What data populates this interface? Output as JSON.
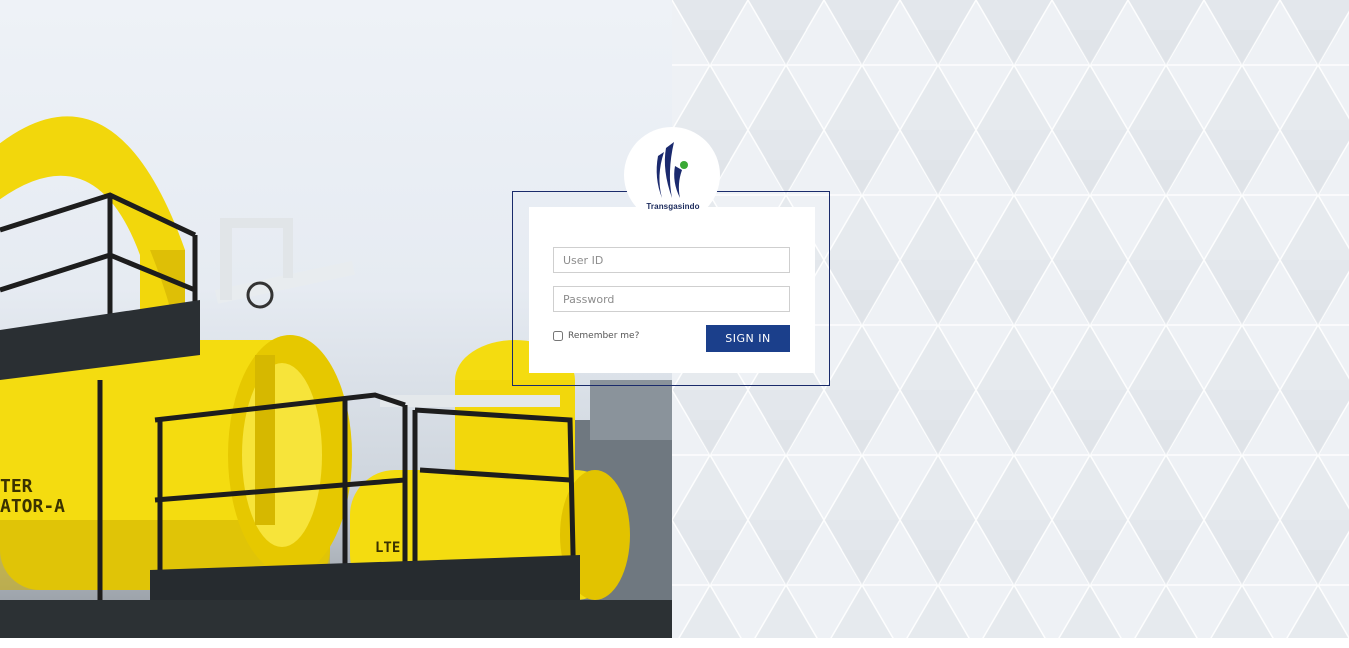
{
  "brand": {
    "name": "Transgasindo",
    "logo_icon": "tgi-logo-icon",
    "primary_color": "#1b3f8b",
    "accent_color": "#3aa935"
  },
  "login": {
    "user_placeholder": "User ID",
    "password_placeholder": "Password",
    "remember_label": "Remember me?",
    "remember_checked": false,
    "submit_label": "SIGN IN"
  },
  "background": {
    "left": "industrial-pipeline-photo",
    "right": "geometric-triangle-pattern"
  }
}
